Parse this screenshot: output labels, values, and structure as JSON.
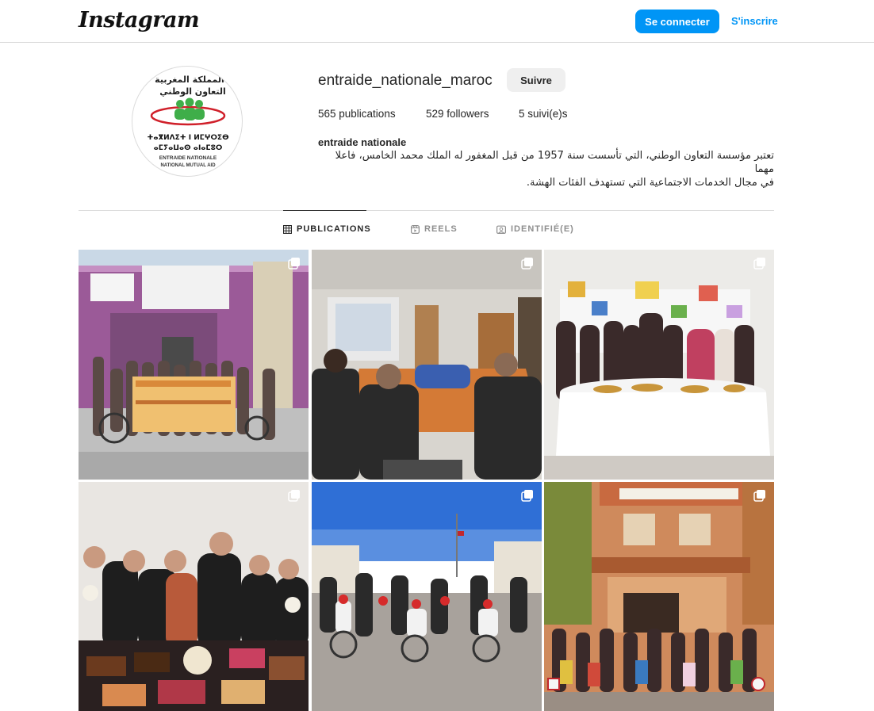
{
  "header": {
    "logo_text": "Instagram",
    "login_label": "Se connecter",
    "signup_label": "S'inscrire"
  },
  "profile": {
    "username": "entraide_nationale_maroc",
    "follow_label": "Suivre",
    "stats": {
      "posts": "565 publications",
      "followers": "529 followers",
      "following": "5 suivi(e)s"
    },
    "full_name": "entraide nationale",
    "bio_line_1": "تعتبر مؤسسة التعاون الوطني، التي تأسست سنة 1957 من قبل المغفور له الملك محمد الخامس، فاعلا مهما",
    "bio_line_2": "في مجال الخدمات الاجتماعية التي تستهدف الفئات الهشة.",
    "avatar_logo": {
      "arabic_line_1": "المملكة المغربية",
      "arabic_line_2": "التعاون الوطني",
      "tifinagh_line_1": "ⵜⴰⴳⵍⴷⵉⵜ ⵏ ⵍⵎⵖⵔⵉⴱ",
      "tifinagh_line_2": "ⴰⵎⵢⴰⵡⴰⵙ ⴰⵏⴰⵎⵓⵔ",
      "french_line_1": "ENTRAIDE NATIONALE",
      "french_line_2": "NATIONAL MUTUAL AID"
    }
  },
  "tabs": [
    {
      "label": "PUBLICATIONS",
      "icon": "grid-icon",
      "active": true
    },
    {
      "label": "REELS",
      "icon": "reels-icon",
      "active": false
    },
    {
      "label": "IDENTIFIÉ(E)",
      "icon": "tagged-icon",
      "active": false
    }
  ],
  "posts": [
    {
      "scene": "group-outdoor-building",
      "multi": true
    },
    {
      "scene": "meeting-room",
      "multi": true
    },
    {
      "scene": "reception-table",
      "multi": true
    },
    {
      "scene": "group-with-pastries",
      "multi": true
    },
    {
      "scene": "outdoor-wheelchair-event",
      "multi": true
    },
    {
      "scene": "children-group-building",
      "multi": true
    }
  ],
  "colors": {
    "accent": "#0095f6",
    "secondary_button": "#efefef",
    "border": "#dbdbdb",
    "text": "#262626",
    "muted": "#8e8e8e"
  }
}
